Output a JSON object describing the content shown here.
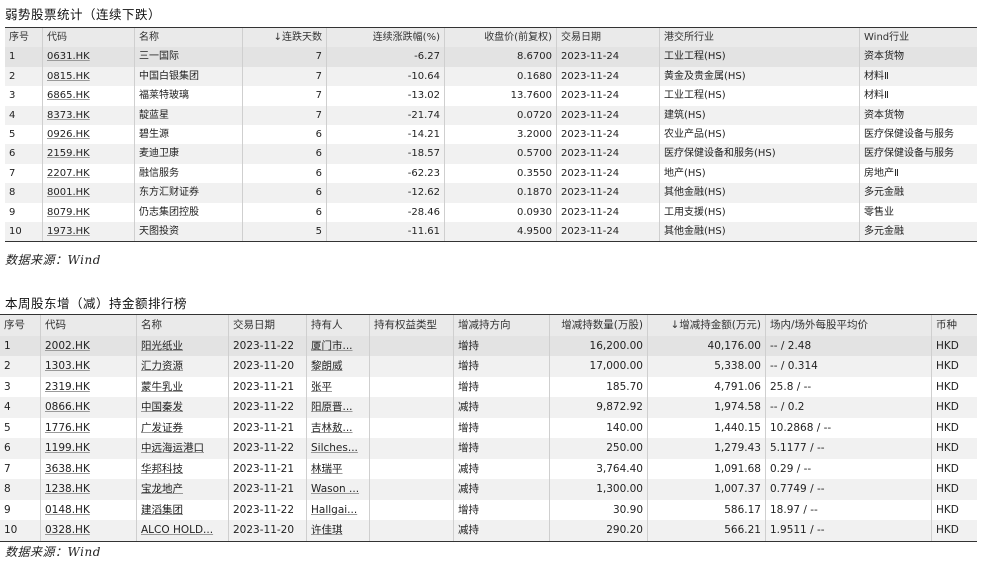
{
  "table1": {
    "title": "弱势股票统计（连续下跌）",
    "source": "数据来源：Wind",
    "headers": [
      "序号",
      "代码",
      "名称",
      "↓连跌天数",
      "连续涨跌幅(%)",
      "收盘价(前复权)",
      "交易日期",
      "港交所行业",
      "Wind行业"
    ],
    "rows": [
      [
        "1",
        "0631.HK",
        "三一国际",
        "7",
        "-6.27",
        "8.6700",
        "2023-11-24",
        "工业工程(HS)",
        "资本货物"
      ],
      [
        "2",
        "0815.HK",
        "中国白银集团",
        "7",
        "-10.64",
        "0.1680",
        "2023-11-24",
        "黄金及贵金属(HS)",
        "材料Ⅱ"
      ],
      [
        "3",
        "6865.HK",
        "福莱特玻璃",
        "7",
        "-13.02",
        "13.7600",
        "2023-11-24",
        "工业工程(HS)",
        "材料Ⅱ"
      ],
      [
        "4",
        "8373.HK",
        "靛蓝星",
        "7",
        "-21.74",
        "0.0720",
        "2023-11-24",
        "建筑(HS)",
        "资本货物"
      ],
      [
        "5",
        "0926.HK",
        "碧生源",
        "6",
        "-14.21",
        "3.2000",
        "2023-11-24",
        "农业产品(HS)",
        "医疗保健设备与服务"
      ],
      [
        "6",
        "2159.HK",
        "麦迪卫康",
        "6",
        "-18.57",
        "0.5700",
        "2023-11-24",
        "医疗保健设备和服务(HS)",
        "医疗保健设备与服务"
      ],
      [
        "7",
        "2207.HK",
        "融信服务",
        "6",
        "-62.23",
        "0.3550",
        "2023-11-24",
        "地产(HS)",
        "房地产Ⅱ"
      ],
      [
        "8",
        "8001.HK",
        "东方汇财证券",
        "6",
        "-12.62",
        "0.1870",
        "2023-11-24",
        "其他金融(HS)",
        "多元金融"
      ],
      [
        "9",
        "8079.HK",
        "仍志集团控股",
        "6",
        "-28.46",
        "0.0930",
        "2023-11-24",
        "工用支援(HS)",
        "零售业"
      ],
      [
        "10",
        "1973.HK",
        "天图投资",
        "5",
        "-11.61",
        "4.9500",
        "2023-11-24",
        "其他金融(HS)",
        "多元金融"
      ]
    ]
  },
  "table2": {
    "title": "本周股东增（减）持金额排行榜",
    "source": "数据来源：Wind",
    "headers": [
      "序号",
      "代码",
      "名称",
      "交易日期",
      "持有人",
      "持有权益类型",
      "增减持方向",
      "增减持数量(万股)",
      "↓增减持金额(万元)",
      "场内/场外每股平均价",
      "币种"
    ],
    "rows": [
      [
        "1",
        "2002.HK",
        "阳光纸业",
        "2023-11-22",
        "厦门市...",
        "",
        "增持",
        "16,200.00",
        "40,176.00",
        "-- / 2.48",
        "HKD"
      ],
      [
        "2",
        "1303.HK",
        "汇力资源",
        "2023-11-20",
        "黎朗威",
        "",
        "增持",
        "17,000.00",
        "5,338.00",
        "-- / 0.314",
        "HKD"
      ],
      [
        "3",
        "2319.HK",
        "蒙牛乳业",
        "2023-11-21",
        "张平",
        "",
        "增持",
        "185.70",
        "4,791.06",
        "25.8 / --",
        "HKD"
      ],
      [
        "4",
        "0866.HK",
        "中国秦发",
        "2023-11-22",
        "阳原晋...",
        "",
        "减持",
        "9,872.92",
        "1,974.58",
        "-- / 0.2",
        "HKD"
      ],
      [
        "5",
        "1776.HK",
        "广发证券",
        "2023-11-21",
        "吉林敖...",
        "",
        "增持",
        "140.00",
        "1,440.15",
        "10.2868 / --",
        "HKD"
      ],
      [
        "6",
        "1199.HK",
        "中远海运港口",
        "2023-11-22",
        "Silches...",
        "",
        "增持",
        "250.00",
        "1,279.43",
        "5.1177 / --",
        "HKD"
      ],
      [
        "7",
        "3638.HK",
        "华邦科技",
        "2023-11-21",
        "林瑞平",
        "",
        "减持",
        "3,764.40",
        "1,091.68",
        "0.29 / --",
        "HKD"
      ],
      [
        "8",
        "1238.HK",
        "宝龙地产",
        "2023-11-21",
        "Wason ...",
        "",
        "减持",
        "1,300.00",
        "1,007.37",
        "0.7749 / --",
        "HKD"
      ],
      [
        "9",
        "0148.HK",
        "建滔集团",
        "2023-11-22",
        "Hallgai...",
        "",
        "增持",
        "30.90",
        "586.17",
        "18.97 / --",
        "HKD"
      ],
      [
        "10",
        "0328.HK",
        "ALCO HOLD...",
        "2023-11-20",
        "许佳琪",
        "",
        "减持",
        "290.20",
        "566.21",
        "1.9511 / --",
        "HKD"
      ]
    ]
  }
}
